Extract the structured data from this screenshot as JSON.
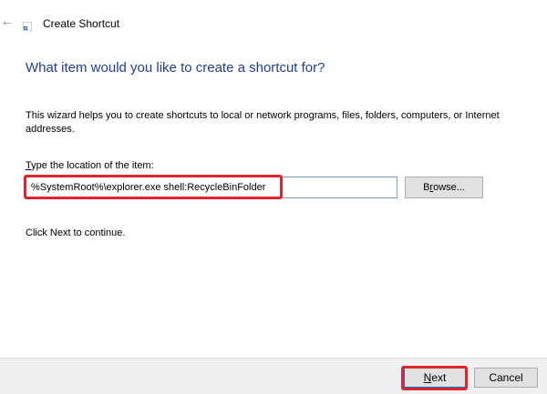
{
  "window": {
    "title": "Create Shortcut",
    "back_icon": "back-arrow-icon",
    "title_icon": "shortcut-icon"
  },
  "wizard": {
    "heading": "What item would you like to create a shortcut for?",
    "description": "This wizard helps you to create shortcuts to local or network programs, files, folders, computers, or Internet addresses.",
    "field_label_accel": "T",
    "field_label_rest": "ype the location of the item:",
    "location_value": "%SystemRoot%\\explorer.exe shell:RecycleBinFolder",
    "browse_accel": "r",
    "browse_prefix": "B",
    "browse_suffix": "owse...",
    "continue_text": "Click Next to continue."
  },
  "footer": {
    "next_accel": "N",
    "next_rest": "ext",
    "cancel_label": "Cancel"
  },
  "colors": {
    "heading": "#1d3f8f",
    "highlight": "#e0242b",
    "footer_bg": "#f0f0f0"
  }
}
